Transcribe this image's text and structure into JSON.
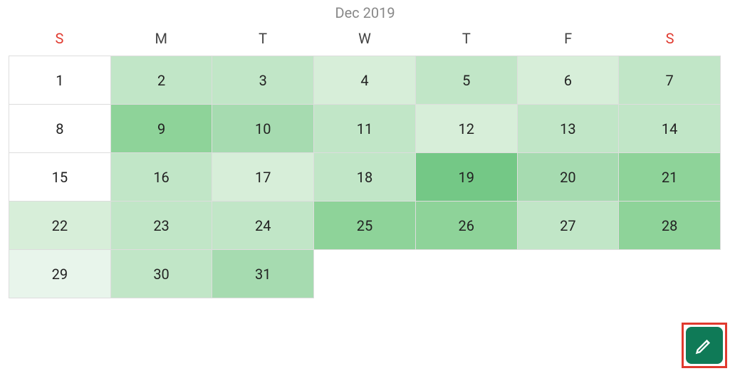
{
  "title": "Dec 2019",
  "weekdays": [
    "S",
    "M",
    "T",
    "W",
    "T",
    "F",
    "S"
  ],
  "intensity_palette": {
    "0": "#ffffff",
    "1": "#e8f5eb",
    "2": "#d7eed9",
    "3": "#c1e6c7",
    "4": "#a6dbb0",
    "5": "#8ed399",
    "6": "#74c886"
  },
  "days": [
    {
      "n": 1,
      "intensity": 0
    },
    {
      "n": 2,
      "intensity": 3
    },
    {
      "n": 3,
      "intensity": 3
    },
    {
      "n": 4,
      "intensity": 2
    },
    {
      "n": 5,
      "intensity": 3
    },
    {
      "n": 6,
      "intensity": 2
    },
    {
      "n": 7,
      "intensity": 3
    },
    {
      "n": 8,
      "intensity": 0
    },
    {
      "n": 9,
      "intensity": 5
    },
    {
      "n": 10,
      "intensity": 4
    },
    {
      "n": 11,
      "intensity": 3
    },
    {
      "n": 12,
      "intensity": 2
    },
    {
      "n": 13,
      "intensity": 3
    },
    {
      "n": 14,
      "intensity": 3
    },
    {
      "n": 15,
      "intensity": 0
    },
    {
      "n": 16,
      "intensity": 3
    },
    {
      "n": 17,
      "intensity": 2
    },
    {
      "n": 18,
      "intensity": 3
    },
    {
      "n": 19,
      "intensity": 6
    },
    {
      "n": 20,
      "intensity": 4
    },
    {
      "n": 21,
      "intensity": 5
    },
    {
      "n": 22,
      "intensity": 2
    },
    {
      "n": 23,
      "intensity": 3
    },
    {
      "n": 24,
      "intensity": 3
    },
    {
      "n": 25,
      "intensity": 5
    },
    {
      "n": 26,
      "intensity": 5
    },
    {
      "n": 27,
      "intensity": 3
    },
    {
      "n": 28,
      "intensity": 5
    },
    {
      "n": 29,
      "intensity": 1
    },
    {
      "n": 30,
      "intensity": 3
    },
    {
      "n": 31,
      "intensity": 4
    }
  ],
  "fab_icon": "pencil-icon"
}
